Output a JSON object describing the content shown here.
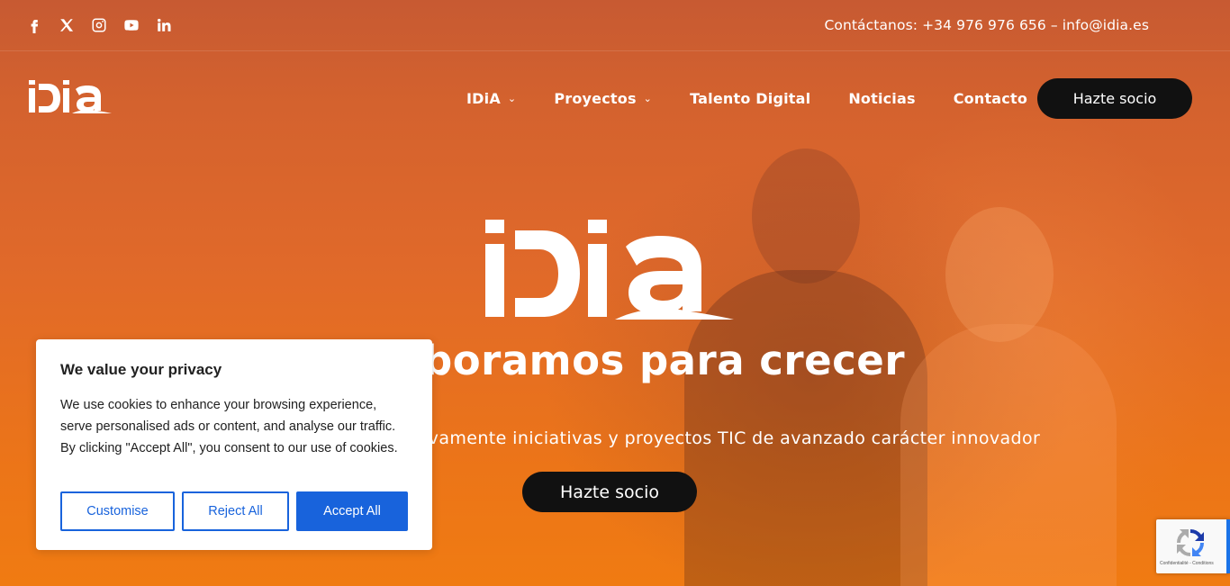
{
  "topbar": {
    "socials": [
      "facebook-icon",
      "x-twitter-icon",
      "instagram-icon",
      "youtube-icon",
      "linkedin-icon"
    ],
    "contact": "Contáctanos: +34 976 976 656 – info@idia.es"
  },
  "header": {
    "logo_text": "iDia",
    "nav": [
      {
        "label": "IDiA",
        "has_dropdown": true
      },
      {
        "label": "Proyectos",
        "has_dropdown": true
      },
      {
        "label": "Talento Digital",
        "has_dropdown": false
      },
      {
        "label": "Noticias",
        "has_dropdown": false
      },
      {
        "label": "Contacto",
        "has_dropdown": false
      }
    ],
    "cta": "Hazte socio"
  },
  "hero": {
    "logo_text": "iDia",
    "headline": "boramos para crecer",
    "subline": "ivamente iniciativas y proyectos TIC de avanzado carácter innovador",
    "cta": "Hazte socio"
  },
  "cookie_banner": {
    "title": "We value your privacy",
    "body": "We use cookies to enhance your browsing experience, serve personalised ads or content, and analyse our traffic. By clicking \"Accept All\", you consent to our use of cookies.",
    "customise": "Customise",
    "reject": "Reject All",
    "accept": "Accept All"
  },
  "recaptcha": {
    "text": "Confidentialité - Conditions"
  },
  "colors": {
    "accent_orange": "#ec7518",
    "button_dark": "#111111",
    "cookie_blue": "#1863dc"
  }
}
